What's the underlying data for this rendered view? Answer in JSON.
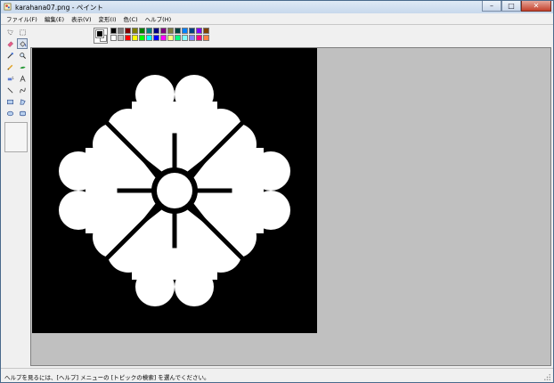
{
  "window": {
    "title": "karahana07.png - ペイント"
  },
  "menubar": {
    "items": [
      "ファイル(F)",
      "編集(E)",
      "表示(V)",
      "変形(I)",
      "色(C)",
      "ヘルプ(H)"
    ]
  },
  "toolbox": {
    "tools": [
      "free-select-icon",
      "rect-select-icon",
      "eraser-icon",
      "fill-icon",
      "color-picker-icon",
      "magnifier-icon",
      "pencil-icon",
      "brush-icon",
      "airbrush-icon",
      "text-icon",
      "line-icon",
      "curve-icon",
      "rectangle-icon",
      "polygon-icon",
      "ellipse-icon",
      "rounded-rect-icon"
    ],
    "selected_tool": "fill-icon"
  },
  "palette": {
    "foreground": "#000000",
    "background": "#ffffff",
    "colors": [
      "#000000",
      "#808080",
      "#800000",
      "#808000",
      "#008000",
      "#008080",
      "#000080",
      "#800080",
      "#808040",
      "#004040",
      "#0080ff",
      "#004080",
      "#8000ff",
      "#804000",
      "#ffffff",
      "#c0c0c0",
      "#ff0000",
      "#ffff00",
      "#00ff00",
      "#00ffff",
      "#0000ff",
      "#ff00ff",
      "#ffff80",
      "#00ff80",
      "#80ffff",
      "#8080ff",
      "#ff0080",
      "#ff8040"
    ]
  },
  "statusbar": {
    "help_text": "ヘルプを見るには、[ヘルプ] メニューの [トピックの検索] を選んでください。"
  }
}
